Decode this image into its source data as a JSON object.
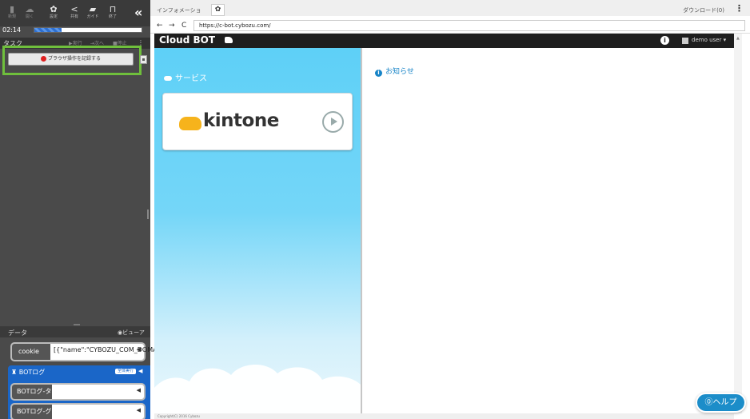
{
  "toolbar": {
    "buttons": [
      {
        "label": "新規",
        "icon": "file-icon"
      },
      {
        "label": "開く",
        "icon": "cloud-icon"
      },
      {
        "label": "設定",
        "icon": "gear-icon"
      },
      {
        "label": "共有",
        "icon": "share-icon"
      },
      {
        "label": "ガイド",
        "icon": "book-icon"
      },
      {
        "label": "終了",
        "icon": "exit-icon"
      }
    ],
    "collapse_glyph": "«",
    "timer": "02:14",
    "progress": 0.25
  },
  "task": {
    "title": "タスク",
    "controls": [
      "▶実行",
      "⇥次へ",
      "■停止",
      "⋮"
    ],
    "record_button": "ブラウザ操作を記録する"
  },
  "data": {
    "title": "データ",
    "viewer": "◉ビューア",
    "cookie": {
      "name": "cookie",
      "value": "[{\"name\":\"CYBOZU_COM_DOMAI"
    },
    "botlog": {
      "title": "BOTログ",
      "badge": "全体実行",
      "rows": [
        "BOTログ-タス",
        "BOTログ-グル"
      ]
    }
  },
  "browser": {
    "tab_label": "インフォメーション",
    "download_label": "ダウンロード(0)",
    "url": "https://c-bot.cybozu.com/"
  },
  "page": {
    "brand": "Cloud BOT",
    "user": "demo user ▾",
    "service_heading": "サービス",
    "service_name": "kintone",
    "news_heading": "お知らせ",
    "footer": "Copyright(C) 2016 Cybozu",
    "help_button": "⓪ヘルプ"
  },
  "colors": {
    "accent": "#1c8dc9",
    "panel_sky": "#5ed0f7",
    "highlight": "#6fbf3c",
    "botlog": "#1a66c8"
  }
}
